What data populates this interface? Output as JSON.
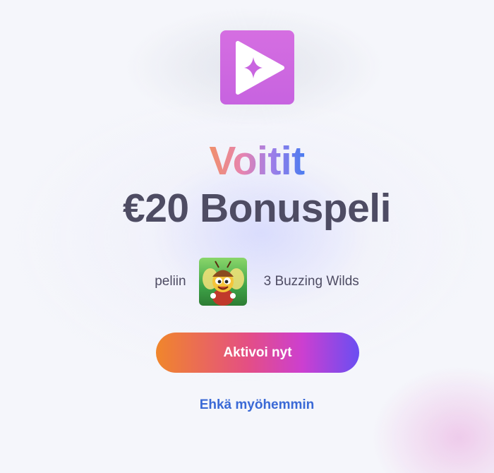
{
  "logo": {
    "icon": "play-sparkle-icon",
    "color": "#c965e0"
  },
  "headline": {
    "line1": "Voitit",
    "line2": "€20 Bonuspeli"
  },
  "game": {
    "prefix": "peliin",
    "thumbnail_icon": "bee-character-icon",
    "name": "3 Buzzing Wilds"
  },
  "actions": {
    "primary_label": "Aktivoi nyt",
    "secondary_label": "Ehkä myöhemmin"
  },
  "colors": {
    "text_dark": "#4e4c63",
    "link": "#3a69d6",
    "button_gradient_start": "#f0862b",
    "button_gradient_end": "#6a4ef2"
  }
}
